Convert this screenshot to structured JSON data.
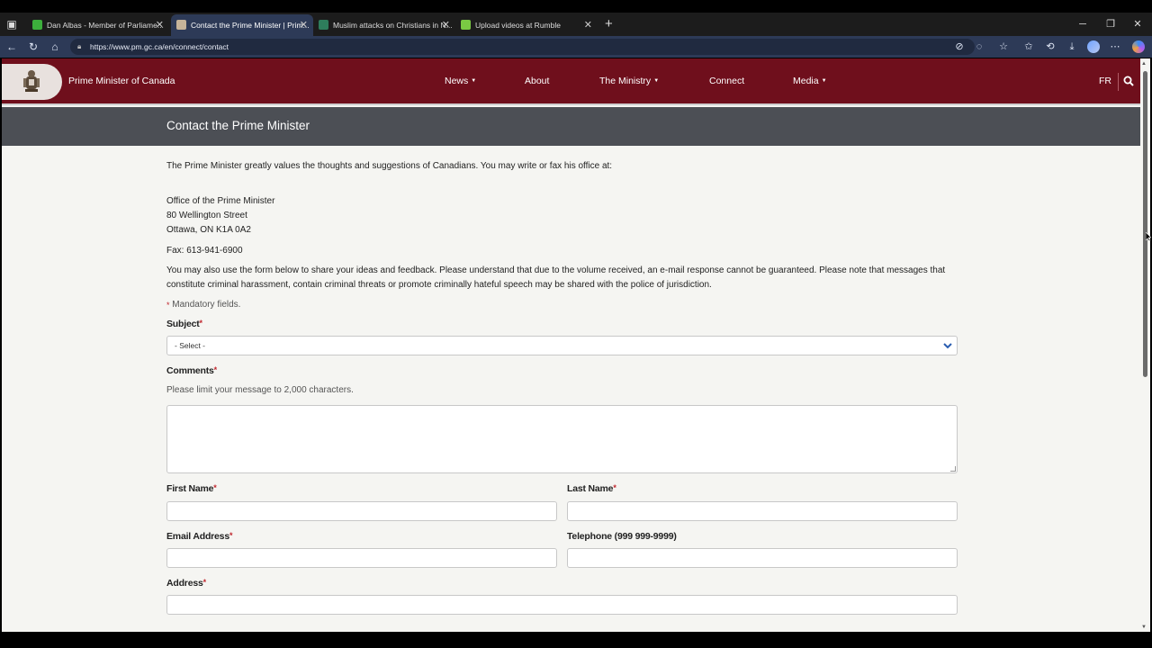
{
  "browser": {
    "tabs": [
      {
        "title": "Dan Albas - Member of Parliame...",
        "color": "#3cae3c",
        "active": false
      },
      {
        "title": "Contact the Prime Minister | Prim...",
        "color": "#c6b49a",
        "active": true
      },
      {
        "title": "Muslim attacks on Christians in N...",
        "color": "#2e7d5c",
        "active": false
      },
      {
        "title": "Upload videos at Rumble",
        "color": "#7ac943",
        "active": false
      }
    ],
    "url": "https://www.pm.gc.ca/en/connect/contact"
  },
  "site": {
    "title": "Prime Minister of Canada",
    "nav": [
      {
        "label": "News",
        "dropdown": true
      },
      {
        "label": "About",
        "dropdown": false
      },
      {
        "label": "The Ministry",
        "dropdown": true
      },
      {
        "label": "Connect",
        "dropdown": false
      },
      {
        "label": "Media",
        "dropdown": true
      }
    ],
    "lang_toggle": "FR",
    "brand_color": "#6f0f1c"
  },
  "page": {
    "heading": "Contact the Prime Minister",
    "intro": "The Prime Minister greatly values the thoughts and suggestions of Canadians. You may write or fax his office at:",
    "address": [
      "Office of the Prime Minister",
      "80 Wellington Street",
      "Ottawa, ON K1A 0A2"
    ],
    "fax": "Fax: 613-941-6900",
    "notice": "You may also use the form below to share your ideas and feedback. Please understand that due to the volume received, an e-mail response cannot be guaranteed. Please note that messages that constitute criminal harassment, contain criminal threats or promote criminally hateful speech may be shared with the police of jurisdiction.",
    "mandatory_marker": "*",
    "mandatory_text": " Mandatory fields."
  },
  "form": {
    "subject_label": "Subject",
    "subject_value": "- Select -",
    "comments_label": "Comments",
    "comments_hint": "Please limit your message to 2,000 characters.",
    "first_name_label": "First Name",
    "last_name_label": "Last Name",
    "email_label": "Email Address",
    "telephone_label": "Telephone (999 999-9999)",
    "address_label": "Address",
    "required_mark": "*"
  }
}
